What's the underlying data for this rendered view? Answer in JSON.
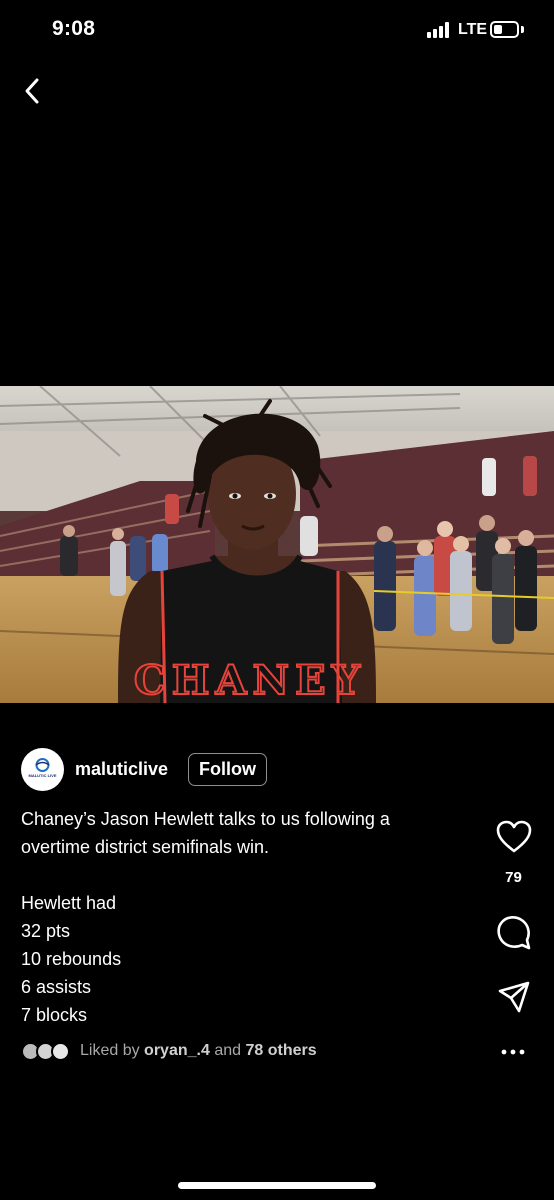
{
  "status_bar": {
    "time": "9:08",
    "network": "LTE",
    "battery_level": 0.4
  },
  "navigation": {
    "back_icon": "chevron-left-icon"
  },
  "video": {
    "description_icon": "video-frame",
    "jersey_text": "CHANEY",
    "colors": {
      "floor": "#b98f4a",
      "bleachers": "#5b2f33",
      "jersey": "#121212",
      "jersey_trim": "#e8433a"
    }
  },
  "post": {
    "username": "maluticlive",
    "avatar_text": "MALUTIC LIVE",
    "follow_label": "Follow",
    "caption_lines": [
      "Chaney’s Jason Hewlett talks to us following a",
      "overtime district semifinals win."
    ],
    "stats_lines": [
      "Hewlett had",
      "32 pts",
      "10 rebounds",
      "6 assists",
      "7 blocks"
    ]
  },
  "actions": {
    "like_icon": "heart-icon",
    "like_count": "79",
    "comment_icon": "comment-bubble-icon",
    "share_icon": "paper-plane-icon",
    "more_icon": "more-dots-icon"
  },
  "likes": {
    "prefix": "Liked by",
    "user": "oryan_.4",
    "middle": "and",
    "others": "78 others"
  }
}
